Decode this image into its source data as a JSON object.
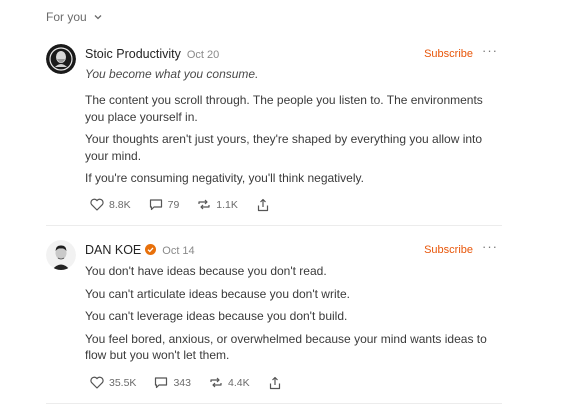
{
  "feed": {
    "label": "For you"
  },
  "posts": [
    {
      "author": "Stoic Productivity",
      "date": "Oct 20",
      "subscribe": "Subscribe",
      "more": "···",
      "tagline": "You become what you consume.",
      "paragraphs": [
        "The content you scroll through. The people you listen to. The environments you place yourself in.",
        "Your thoughts aren't just yours, they're shaped by everything you allow into your mind.",
        "If you're consuming negativity, you'll think negatively."
      ],
      "likes": "8.8K",
      "comments": "79",
      "restacks": "1.1K"
    },
    {
      "author": "DAN KOE",
      "date": "Oct 14",
      "subscribe": "Subscribe",
      "more": "···",
      "verified_color": "#e8700a",
      "paragraphs": [
        "You don't have ideas because you don't read.",
        "You can't articulate ideas because you don't write.",
        "You can't leverage ideas because you don't build.",
        "You feel bored, anxious, or overwhelmed because your mind wants ideas to flow but you won't let them."
      ],
      "likes": "35.5K",
      "comments": "343",
      "restacks": "4.4K"
    }
  ],
  "icons": {
    "like": "heart-icon",
    "comment": "comment-icon",
    "restack": "restack-icon",
    "share": "share-icon"
  }
}
